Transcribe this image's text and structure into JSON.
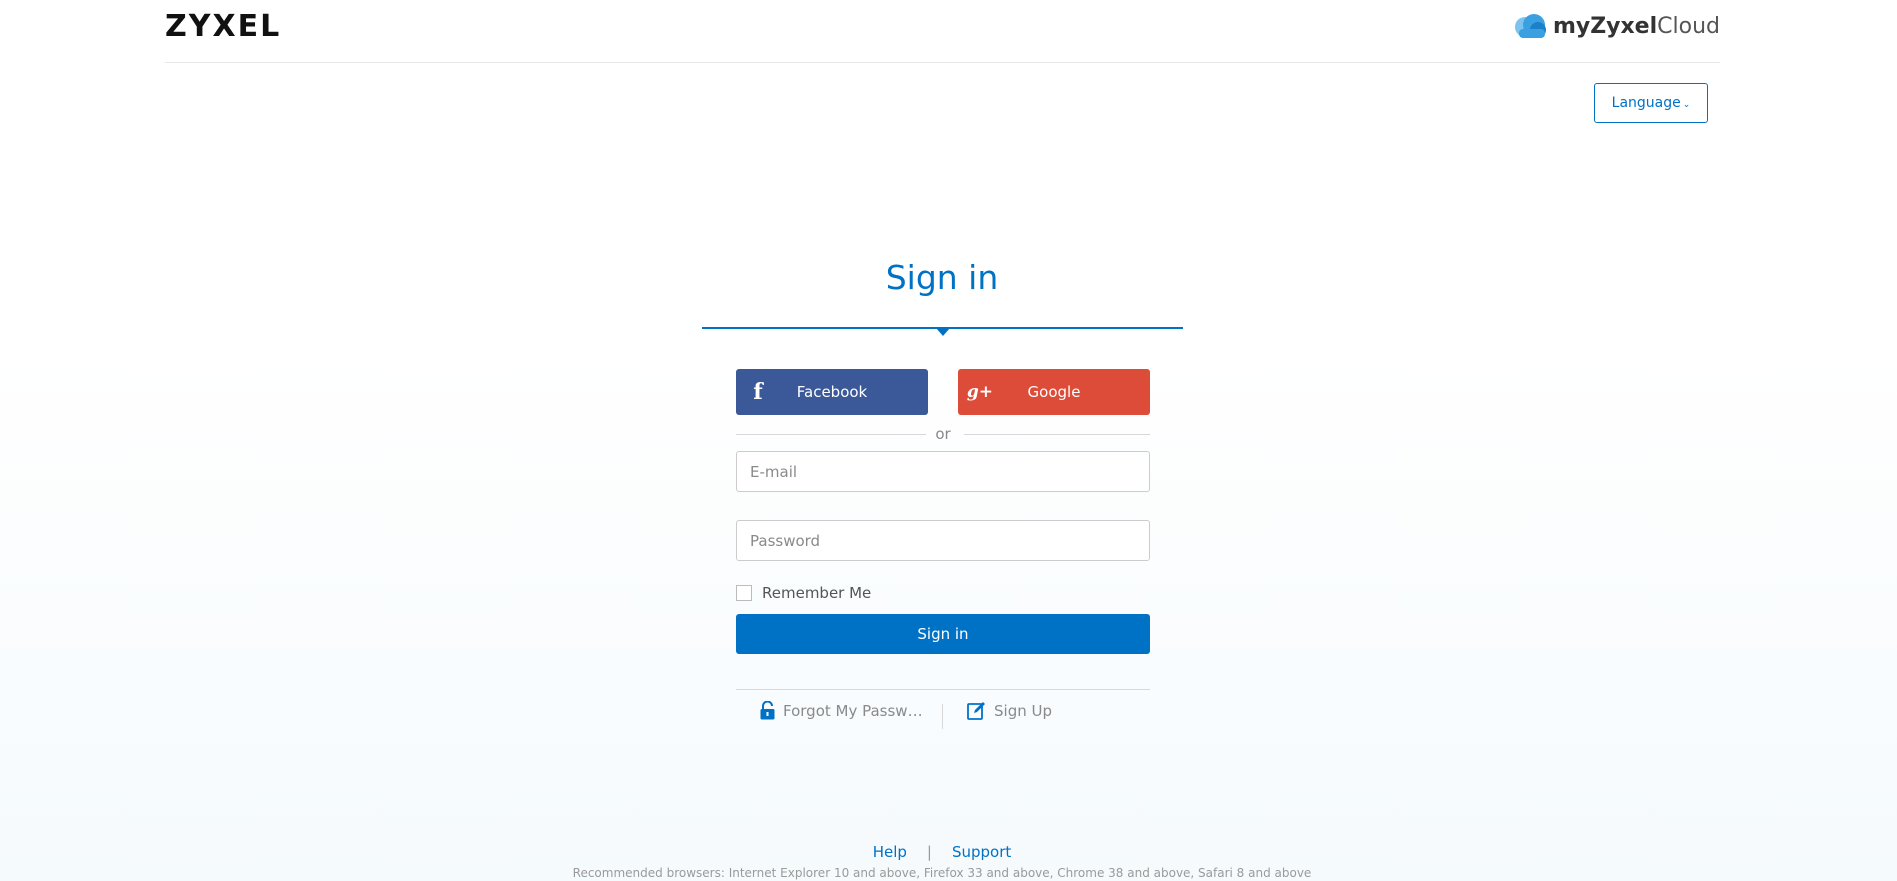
{
  "header": {
    "brand": "ZYXEL",
    "cloud_logo_bold": "myZyxel",
    "cloud_logo_rest": "Cloud"
  },
  "language": {
    "label": "Language",
    "chevron": "⌄"
  },
  "signin": {
    "title": "Sign in",
    "facebook_label": "Facebook",
    "facebook_glyph": "f",
    "google_label": "Google",
    "google_glyph": "g+",
    "or_text": "or",
    "email_placeholder": "E-mail",
    "email_value": "",
    "password_placeholder": "Password",
    "password_value": "",
    "remember_label": "Remember Me",
    "remember_checked": false,
    "submit_label": "Sign in",
    "forgot_label": "Forgot My Password",
    "signup_label": "Sign Up"
  },
  "footer": {
    "help_label": "Help",
    "separator": "|",
    "support_label": "Support",
    "browsers_note": "Recommended browsers: Internet Explorer 10 and above, Firefox 33 and above, Chrome 38 and above, Safari 8 and above"
  },
  "colors": {
    "accent": "#0072c6",
    "facebook": "#3b5998",
    "google": "#dd4b39"
  },
  "icons": {
    "forgot": "lock-icon",
    "signup": "edit-icon",
    "cloud": "cloud-icon"
  }
}
